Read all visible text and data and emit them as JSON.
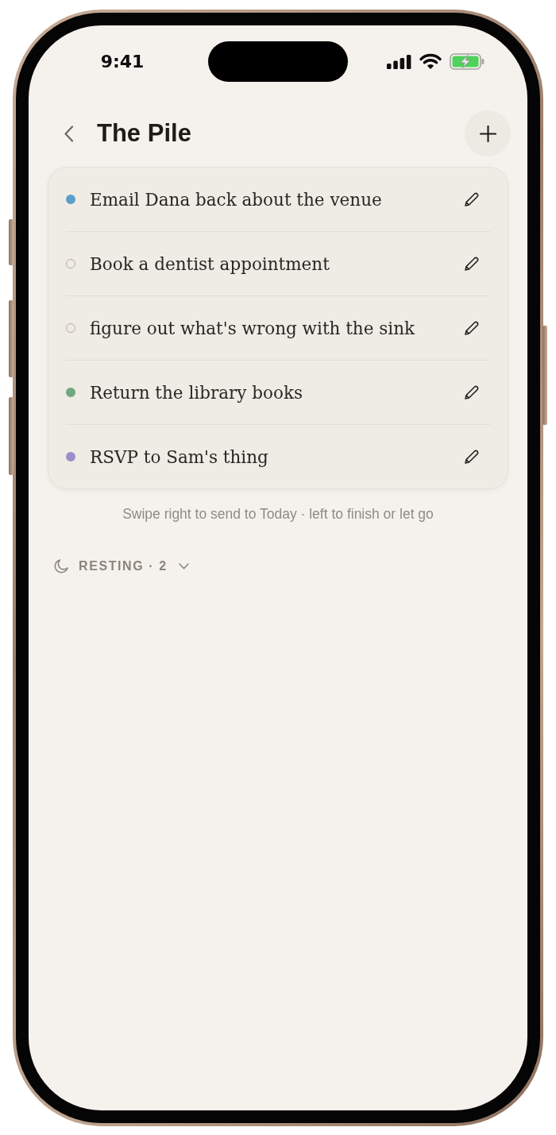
{
  "status_bar": {
    "time": "9:41"
  },
  "header": {
    "title": "The Pile"
  },
  "tasks": [
    {
      "text": "Email Dana back about the venue",
      "kind": "dot",
      "color": "#5b9ec9"
    },
    {
      "text": "Book a dentist appointment",
      "kind": "ring",
      "color": "#b3aca4"
    },
    {
      "text": "figure out what's wrong with the sink",
      "kind": "ring",
      "color": "#b3aca4"
    },
    {
      "text": "Return the library books",
      "kind": "dot",
      "color": "#6fa882"
    },
    {
      "text": "RSVP to Sam's thing",
      "kind": "dot",
      "color": "#9b8fcb"
    }
  ],
  "hint": "Swipe right to send to Today · left to finish or let go",
  "resting": {
    "label": "RESTING · 2",
    "expanded": false
  }
}
